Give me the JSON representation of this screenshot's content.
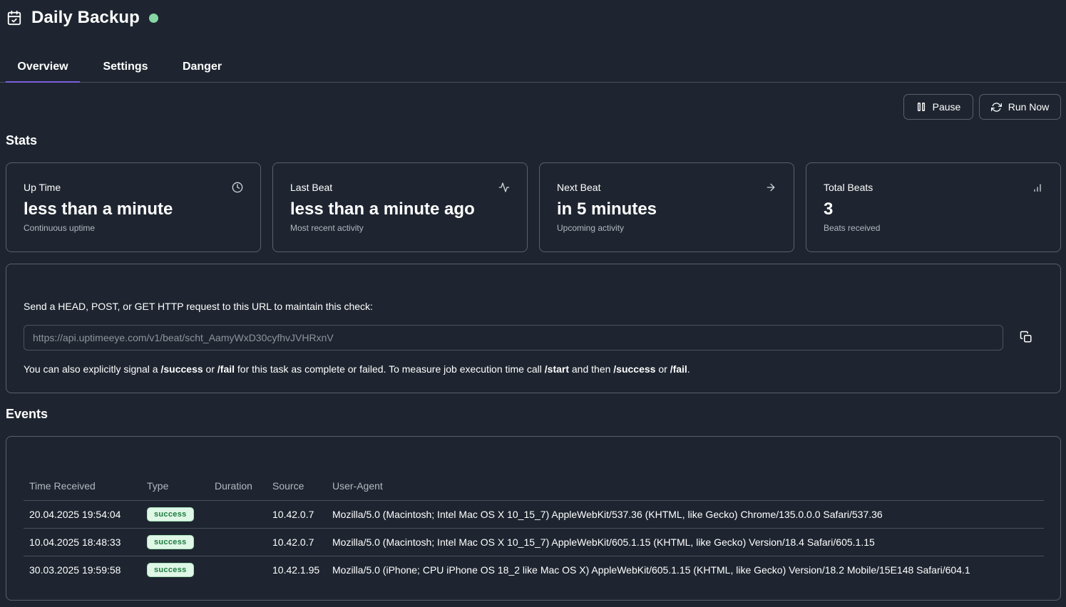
{
  "header": {
    "title": "Daily Backup",
    "status_color": "#86d7a3"
  },
  "tabs": [
    {
      "label": "Overview",
      "active": true
    },
    {
      "label": "Settings",
      "active": false
    },
    {
      "label": "Danger",
      "active": false
    }
  ],
  "actions": {
    "pause_label": "Pause",
    "run_now_label": "Run Now"
  },
  "stats": {
    "title": "Stats",
    "cards": [
      {
        "label": "Up Time",
        "value": "less than a minute",
        "sub": "Continuous uptime",
        "icon": "clock-icon"
      },
      {
        "label": "Last Beat",
        "value": "less than a minute ago",
        "sub": "Most recent activity",
        "icon": "activity-icon"
      },
      {
        "label": "Next Beat",
        "value": "in 5 minutes",
        "sub": "Upcoming activity",
        "icon": "arrow-right-icon"
      },
      {
        "label": "Total Beats",
        "value": "3",
        "sub": "Beats received",
        "icon": "bar-chart-icon"
      }
    ]
  },
  "endpoint": {
    "intro": "Send a HEAD, POST, or GET HTTP request to this URL to maintain this check:",
    "url": "https://api.uptimeeye.com/v1/beat/scht_AamyWxD30cyfhvJVHRxnV",
    "note_parts": [
      {
        "text": "You can also explicitly signal a ",
        "bold": false
      },
      {
        "text": "/success",
        "bold": true
      },
      {
        "text": " or ",
        "bold": false
      },
      {
        "text": "/fail",
        "bold": true
      },
      {
        "text": " for this task as complete or failed. To measure job execution time call ",
        "bold": false
      },
      {
        "text": "/start",
        "bold": true
      },
      {
        "text": " and then ",
        "bold": false
      },
      {
        "text": "/success",
        "bold": true
      },
      {
        "text": " or ",
        "bold": false
      },
      {
        "text": "/fail",
        "bold": true
      },
      {
        "text": ".",
        "bold": false
      }
    ]
  },
  "events": {
    "title": "Events",
    "columns": [
      "Time Received",
      "Type",
      "Duration",
      "Source",
      "User-Agent"
    ],
    "rows": [
      {
        "time": "20.04.2025 19:54:04",
        "type": "success",
        "duration": "",
        "source": "10.42.0.7",
        "user_agent": "Mozilla/5.0 (Macintosh; Intel Mac OS X 10_15_7) AppleWebKit/537.36 (KHTML, like Gecko) Chrome/135.0.0.0 Safari/537.36"
      },
      {
        "time": "10.04.2025 18:48:33",
        "type": "success",
        "duration": "",
        "source": "10.42.0.7",
        "user_agent": "Mozilla/5.0 (Macintosh; Intel Mac OS X 10_15_7) AppleWebKit/605.1.15 (KHTML, like Gecko) Version/18.4 Safari/605.1.15"
      },
      {
        "time": "30.03.2025 19:59:58",
        "type": "success",
        "duration": "",
        "source": "10.42.1.95",
        "user_agent": "Mozilla/5.0 (iPhone; CPU iPhone OS 18_2 like Mac OS X) AppleWebKit/605.1.15 (KHTML, like Gecko) Version/18.2 Mobile/15E148 Safari/604.1"
      }
    ]
  }
}
